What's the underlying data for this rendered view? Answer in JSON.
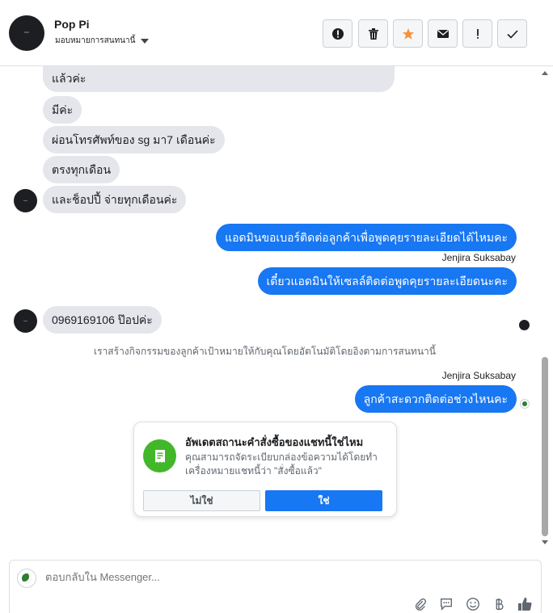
{
  "header": {
    "contact_name": "Pop Pi",
    "assign_label": "มอบหมายการสนทนานี้",
    "actions": [
      "mark-spam",
      "delete",
      "star",
      "mark-unread",
      "flag",
      "done"
    ]
  },
  "messages": [
    {
      "dir": "in",
      "text": "แล้วค่ะ"
    },
    {
      "dir": "in",
      "text": "มีค่ะ"
    },
    {
      "dir": "in",
      "text": "ผ่อนโทรศัพท์ของ sg มา7 เดือนค่ะ"
    },
    {
      "dir": "in",
      "text": "ตรงทุกเดือน"
    },
    {
      "dir": "in",
      "text": "และช็อปปี้ จ่ายทุกเดือนค่ะ"
    },
    {
      "dir": "out",
      "text": "แอดมินขอเบอร์ติดต่อลูกค้าเพื่อพูดคุยรายละเอียดได้ไหมคะ"
    },
    {
      "dir": "out",
      "sender": "Jenjira Suksabay",
      "text": "เดี๋ยวแอดมินให้เซลล์ติดต่อพูดคุยรายละเอียดนะคะ"
    },
    {
      "dir": "in",
      "text": "0969169106 ป๊อปค่ะ"
    },
    {
      "dir": "out",
      "sender": "Jenjira Suksabay",
      "text": "ลูกค้าสะดวกติดต่อช่วงไหนคะ"
    }
  ],
  "system_note": "เราสร้างกิจกรรมของลูกค้าเป้าหมายให้กับคุณโดยอัตโนมัติโดยอิงตามการสนทนานี้",
  "card": {
    "title": "อัพเดตสถานะคำสั่งซื้อของแชทนี้ใช่ไหม",
    "body": "คุณสามารถจัดระเบียบกล่องข้อความได้โดยทำเครื่องหมายแชทนี้ว่า \"สั่งซื้อแล้ว\"",
    "no_label": "ไม่ใช่",
    "yes_label": "ใช่"
  },
  "composer": {
    "placeholder": "ตอบกลับใน Messenger...",
    "icons": [
      "attachment-icon",
      "saved-reply-icon",
      "emoji-icon",
      "payment-icon",
      "like-icon"
    ]
  },
  "colors": {
    "accent": "#1877f2",
    "incoming_bubble": "#e4e6eb",
    "card_icon_bg": "#42b72a"
  }
}
